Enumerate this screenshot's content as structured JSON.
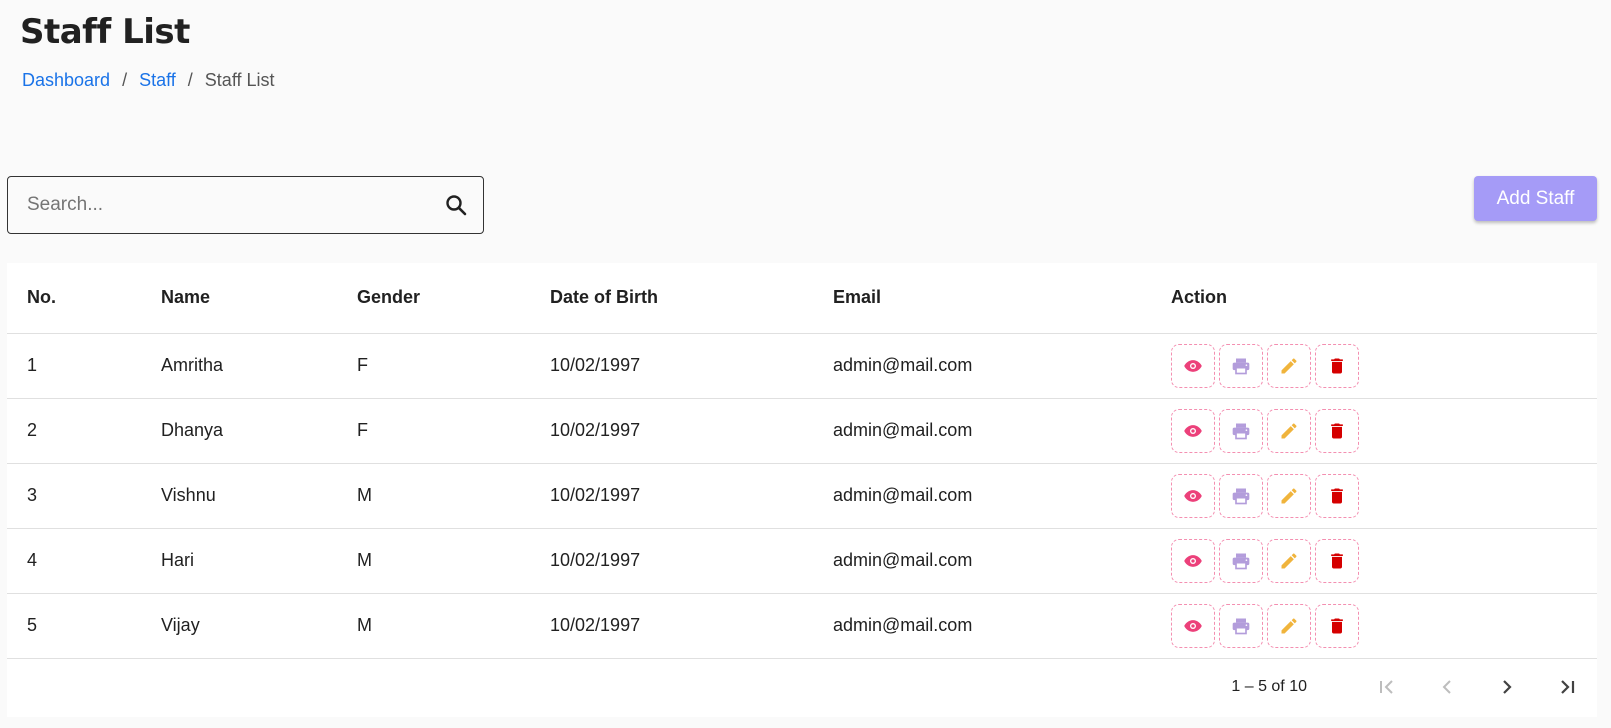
{
  "page": {
    "title": "Staff List"
  },
  "breadcrumb": {
    "items": [
      "Dashboard",
      "Staff"
    ],
    "current": "Staff List",
    "separator": "/"
  },
  "search": {
    "placeholder": "Search...",
    "value": ""
  },
  "add_button": {
    "label": "Add Staff"
  },
  "table": {
    "headers": [
      "No.",
      "Name",
      "Gender",
      "Date of Birth",
      "Email",
      "Action"
    ],
    "rows": [
      [
        "1",
        "Amritha",
        "F",
        "10/02/1997",
        "admin@mail.com"
      ],
      [
        "2",
        "Dhanya",
        "F",
        "10/02/1997",
        "admin@mail.com"
      ],
      [
        "3",
        "Vishnu",
        "M",
        "10/02/1997",
        "admin@mail.com"
      ],
      [
        "4",
        "Hari",
        "M",
        "10/02/1997",
        "admin@mail.com"
      ],
      [
        "5",
        "Vijay",
        "M",
        "10/02/1997",
        "admin@mail.com"
      ]
    ],
    "actions": [
      "eye-icon",
      "printer-icon",
      "pencil-icon",
      "trash-icon"
    ]
  },
  "pagination": {
    "range": "1 – 5 of 10"
  },
  "colors": {
    "link": "#1a73e8",
    "add_button": "#a59bf7",
    "view": "#ec407a",
    "print": "#b39ddb",
    "edit": "#f0b43c",
    "delete": "#d50000",
    "action_border": "#f48fb1"
  }
}
